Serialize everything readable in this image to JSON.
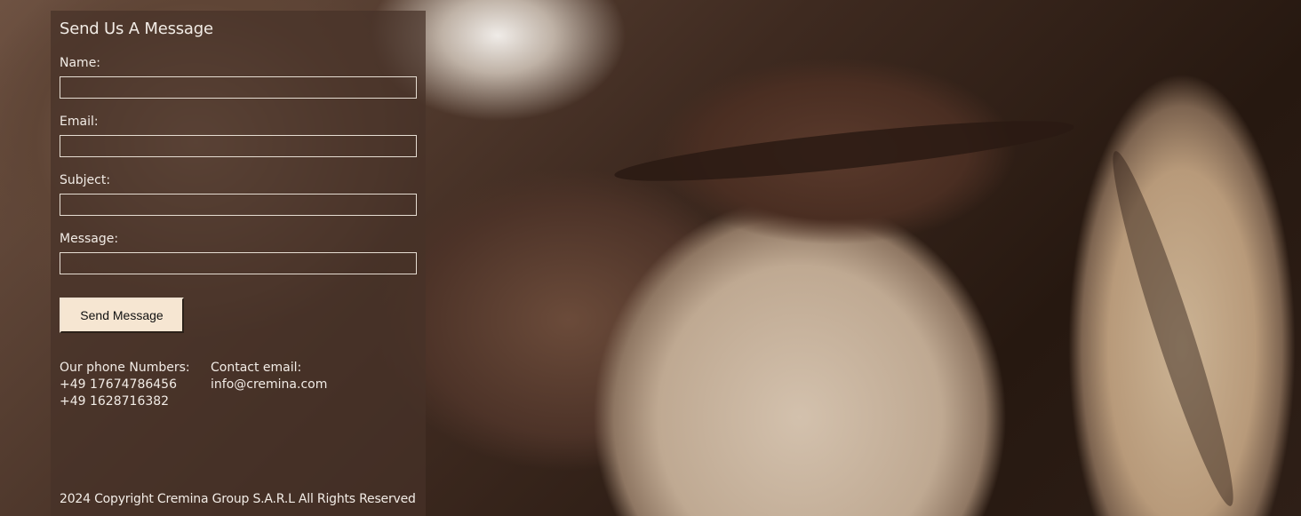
{
  "form": {
    "title": "Send Us A Message",
    "fields": [
      {
        "label": "Name:",
        "value": ""
      },
      {
        "label": "Email:",
        "value": ""
      },
      {
        "label": "Subject:",
        "value": ""
      },
      {
        "label": "Message:",
        "value": ""
      }
    ],
    "submit_label": "Send Message"
  },
  "contact": {
    "phone_heading": "Our phone Numbers:",
    "phones": [
      "+49 17674786456",
      "+49 1628716382"
    ],
    "email_heading": "Contact email:",
    "email": "info@cremina.com"
  },
  "footer": {
    "copyright": "2024 Copyright Cremina Group S.A.R.L All Rights Reserved"
  },
  "colors": {
    "panel_overlay": "#46322880",
    "button_bg": "#f6e6d2",
    "text": "#f2ece6"
  }
}
